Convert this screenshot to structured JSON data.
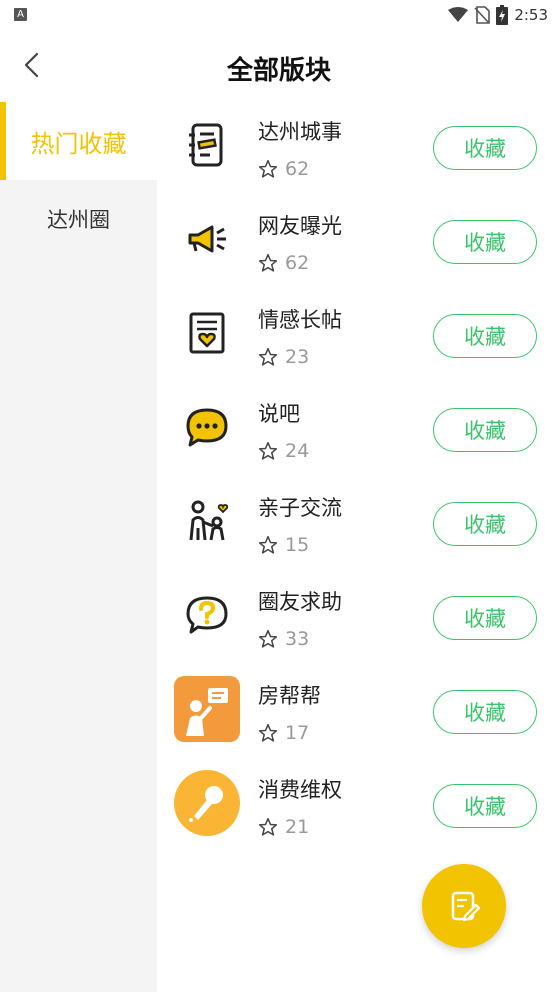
{
  "status_bar": {
    "time": "2:53",
    "left_badge": "A"
  },
  "header": {
    "title": "全部版块"
  },
  "sidebar": {
    "items": [
      {
        "label": "热门收藏",
        "active": true
      },
      {
        "label": "达州圈",
        "active": false
      }
    ]
  },
  "forums": [
    {
      "name": "达州城事",
      "count": "62",
      "icon": "notebook-icon"
    },
    {
      "name": "网友曝光",
      "count": "62",
      "icon": "megaphone-icon"
    },
    {
      "name": "情感长帖",
      "count": "23",
      "icon": "letter-heart-icon"
    },
    {
      "name": "说吧",
      "count": "24",
      "icon": "chat-bubble-icon"
    },
    {
      "name": "亲子交流",
      "count": "15",
      "icon": "parent-child-icon"
    },
    {
      "name": "圈友求助",
      "count": "33",
      "icon": "question-bubble-icon"
    },
    {
      "name": "房帮帮",
      "count": "17",
      "icon": "house-help-icon"
    },
    {
      "name": "消费维权",
      "count": "21",
      "icon": "microphone-icon"
    }
  ],
  "buttons": {
    "favorite_label": "收藏"
  },
  "colors": {
    "accent_yellow": "#f2c300",
    "button_green": "#3cc46a"
  }
}
